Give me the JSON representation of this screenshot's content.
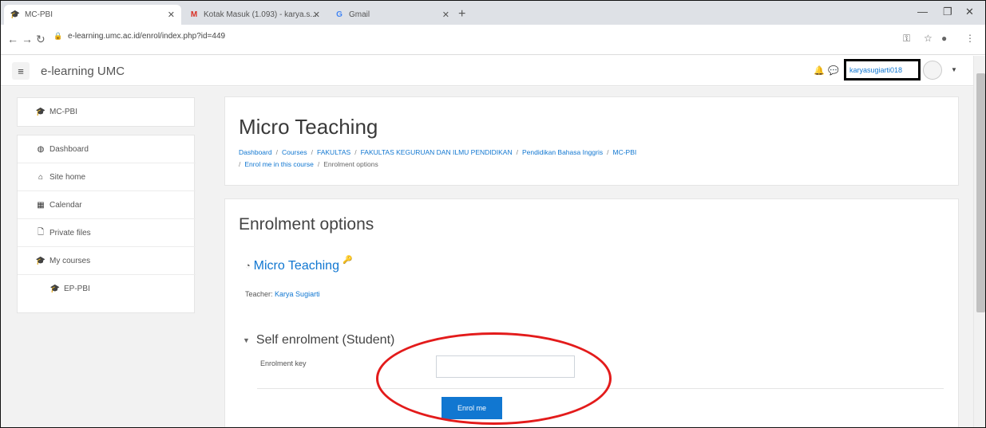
{
  "browser": {
    "tabs": [
      {
        "title": "MC-PBI",
        "icon": "moodle-cap-icon",
        "active": true
      },
      {
        "title": "Kotak Masuk (1.093) - karya.s...",
        "icon": "gmail-icon",
        "active": false
      },
      {
        "title": "Gmail",
        "icon": "google-icon",
        "active": false
      }
    ],
    "new_tab": "+",
    "url": "e-learning.umc.ac.id/enrol/index.php?id=449"
  },
  "navbar": {
    "menu_icon": "≡",
    "site_name": "e-learning UMC",
    "user_name": "karyasugiarti018"
  },
  "sidebar": {
    "top_items": [
      {
        "label": "MC-PBI",
        "icon": "graduation-cap-icon"
      }
    ],
    "main_items": [
      {
        "label": "Dashboard",
        "icon": "dashboard-icon"
      },
      {
        "label": "Site home",
        "icon": "home-icon"
      },
      {
        "label": "Calendar",
        "icon": "calendar-icon"
      },
      {
        "label": "Private files",
        "icon": "file-icon"
      },
      {
        "label": "My courses",
        "icon": "graduation-cap-icon"
      },
      {
        "label": "EP-PBI",
        "icon": "graduation-cap-icon"
      }
    ]
  },
  "header": {
    "title": "Micro Teaching",
    "breadcrumb": [
      "Dashboard",
      "Courses",
      "FAKULTAS",
      "FAKULTAS KEGURUAN DAN ILMU PENDIDIKAN",
      "Pendidikan Bahasa Inggris",
      "MC-PBI",
      "Enrol me in this course",
      "Enrolment options"
    ]
  },
  "main": {
    "section_title": "Enrolment options",
    "course_name": "Micro Teaching",
    "teacher_label": "Teacher:",
    "teacher_name": "Karya Sugiarti",
    "self_enrolment_title": "Self enrolment (Student)",
    "enrolment_key_label": "Enrolment key",
    "enrolment_key_value": "",
    "enrol_button": "Enrol me"
  },
  "annotation_colors": {
    "ellipse": "#e31b1b",
    "box": "#000000"
  }
}
